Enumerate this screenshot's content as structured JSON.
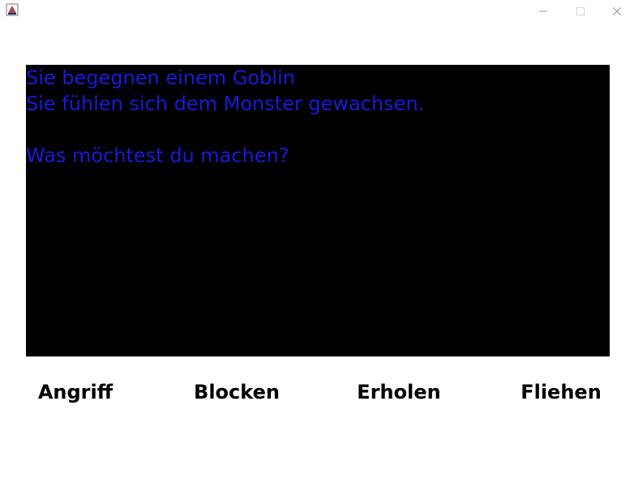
{
  "window": {
    "icons": {
      "app": "java-app-icon",
      "minimize": "minimize-icon",
      "maximize": "maximize-icon",
      "close": "close-icon"
    }
  },
  "console": {
    "lines": [
      "Sie begegnen einem Goblin",
      "Sie fühlen sich dem Monster gewachsen.",
      "",
      "Was möchtest du machen?"
    ],
    "text_color": "#1a1adb",
    "background_color": "#000000"
  },
  "actions": [
    {
      "label": "Angriff"
    },
    {
      "label": "Blocken"
    },
    {
      "label": "Erholen"
    },
    {
      "label": "Fliehen"
    }
  ]
}
